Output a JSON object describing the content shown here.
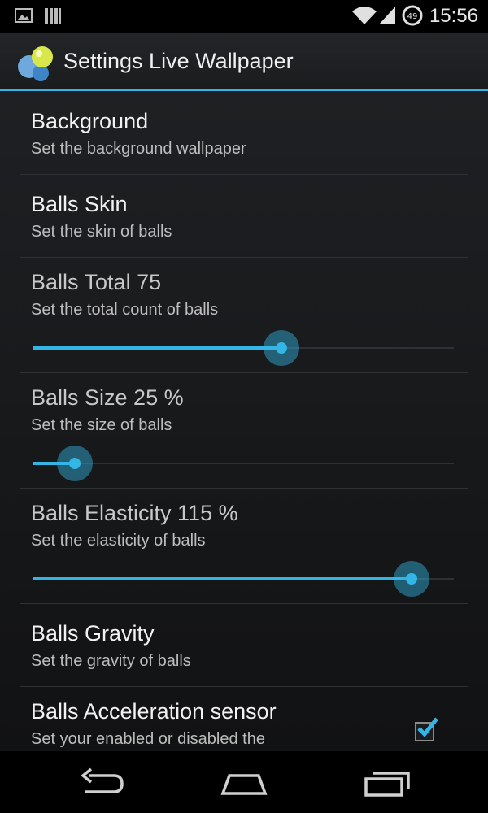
{
  "status_bar": {
    "time": "15:56",
    "battery_level": "49",
    "icons": [
      "image-icon",
      "signal-bars-icon",
      "wifi-icon",
      "cell-signal-icon",
      "battery-icon"
    ]
  },
  "action_bar": {
    "title": "Settings Live Wallpaper",
    "icon": "balls-app-icon"
  },
  "preferences": [
    {
      "title": "Background",
      "summary": "Set the background wallpaper"
    },
    {
      "title": "Balls Skin",
      "summary": "Set the skin of balls"
    },
    {
      "title": "Balls Total 75",
      "summary": "Set the total count of balls",
      "slider_fraction": 0.59
    },
    {
      "title": "Balls Size 25 %",
      "summary": "Set the size of balls",
      "slider_fraction": 0.1
    },
    {
      "title": "Balls Elasticity 115 %",
      "summary": "Set the elasticity of balls",
      "slider_fraction": 0.9
    },
    {
      "title": "Balls Gravity",
      "summary": "Set the gravity of balls"
    },
    {
      "title": "Balls Acceleration sensor",
      "summary": "Set your enabled or disabled the",
      "checked": true
    }
  ],
  "nav_bar": {
    "buttons": [
      "back-icon",
      "home-icon",
      "recents-icon"
    ]
  },
  "colors": {
    "accent": "#33b5e5",
    "background": "#1a1c1e"
  }
}
